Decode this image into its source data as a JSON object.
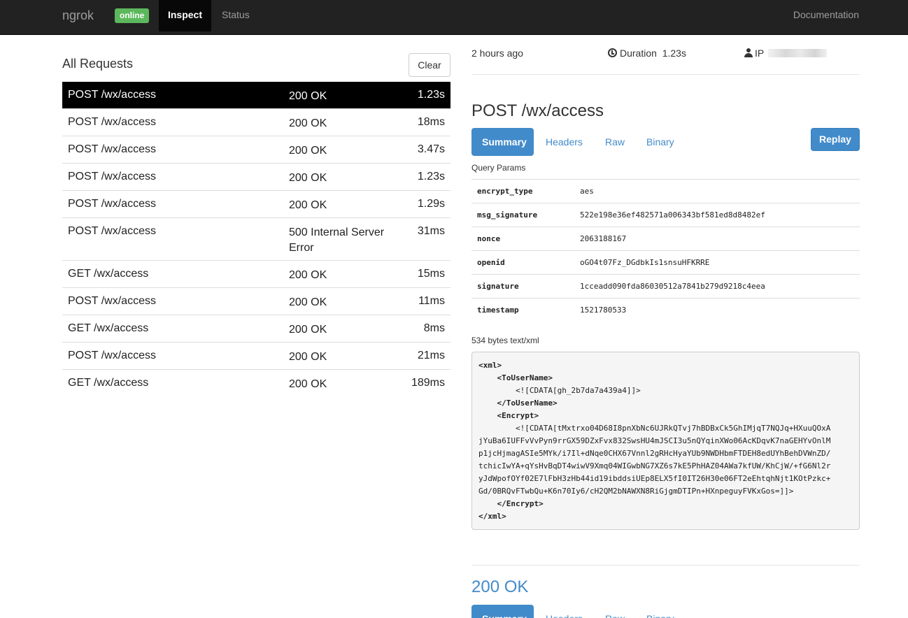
{
  "navbar": {
    "brand": "ngrok",
    "badge": "online",
    "items": [
      "Inspect",
      "Status"
    ],
    "docs": "Documentation"
  },
  "requests": {
    "title": "All Requests",
    "clear_label": "Clear",
    "rows": [
      {
        "path": "POST /wx/access",
        "status": "200 OK",
        "duration": "1.23s",
        "active": true
      },
      {
        "path": "POST /wx/access",
        "status": "200 OK",
        "duration": "18ms"
      },
      {
        "path": "POST /wx/access",
        "status": "200 OK",
        "duration": "3.47s"
      },
      {
        "path": "POST /wx/access",
        "status": "200 OK",
        "duration": "1.23s"
      },
      {
        "path": "POST /wx/access",
        "status": "200 OK",
        "duration": "1.29s"
      },
      {
        "path": "POST /wx/access",
        "status": "500 Internal Server Error",
        "duration": "31ms"
      },
      {
        "path": "GET /wx/access",
        "status": "200 OK",
        "duration": "15ms"
      },
      {
        "path": "POST /wx/access",
        "status": "200 OK",
        "duration": "11ms"
      },
      {
        "path": "GET /wx/access",
        "status": "200 OK",
        "duration": "8ms"
      },
      {
        "path": "POST /wx/access",
        "status": "200 OK",
        "duration": "21ms"
      },
      {
        "path": "GET /wx/access",
        "status": "200 OK",
        "duration": "189ms"
      }
    ]
  },
  "detail": {
    "time_ago": "2 hours ago",
    "duration_label": "Duration",
    "duration_value": "1.23s",
    "ip_label": "IP",
    "request_title": "POST /wx/access",
    "tabs": [
      "Summary",
      "Headers",
      "Raw",
      "Binary"
    ],
    "replay_label": "Replay",
    "query_params_label": "Query Params",
    "query_params": [
      {
        "key": "encrypt_type",
        "value": "aes"
      },
      {
        "key": "msg_signature",
        "value": "522e198e36ef482571a006343bf581ed8d8482ef"
      },
      {
        "key": "nonce",
        "value": "2063188167"
      },
      {
        "key": "openid",
        "value": "oGO4t07Fz_DGdbkIs1snsuHFKRRE"
      },
      {
        "key": "signature",
        "value": "1cceadd090fda86030512a7841b279d9218c4eea"
      },
      {
        "key": "timestamp",
        "value": "1521780533"
      }
    ],
    "body_label": "534 bytes text/xml",
    "body_lines": [
      "<xml>",
      "    <ToUserName>",
      "        <![CDATA[gh_2b7da7a439a4]]>",
      "    </ToUserName>",
      "    <Encrypt>",
      "        <![CDATA[tMxtrxo04D68I8pnXbNc6UJRkQTvj7hBDBxCk5GhIMjqT7NQJq+HXuuQOxA",
      "jYuBa6IUFFvVvPyn9rrGX59DZxFvx832SwsHU4mJSCI3u5nQYqinXWo06AcKDqvK7naGEHYvOnlM",
      "p1jcHjmagASIe5MYk/i7Il+dNqe0CHX67Vnnl2gRHcHyaYUb9NWDHbmFTDEH8edUYhBehDVWnZD/",
      "tchicIwYA+qYsHvBqDT4wiwV9Xmq04WIGwbNG7XZ6s7kE5PhHAZ04AWa7kfUW/KhCjW/+fG6Nl2r",
      "yJdWpofOYf02E7lFbH3zHb44id19ibddsiUEp8ELX5fI0IT26H30e06FT2eEhtqhNjt1KOtPzkc+",
      "Gd/0BRQvFTwbQu+K6n70Iy6/cH2QM2bNAWXN8RiGjgmDTIPn+HXnpeguyFVKxGos=]]>",
      "    </Encrypt>",
      "</xml>"
    ],
    "response_title": "200 OK",
    "response_tabs": [
      "Summary",
      "Headers",
      "Raw",
      "Binary"
    ]
  }
}
